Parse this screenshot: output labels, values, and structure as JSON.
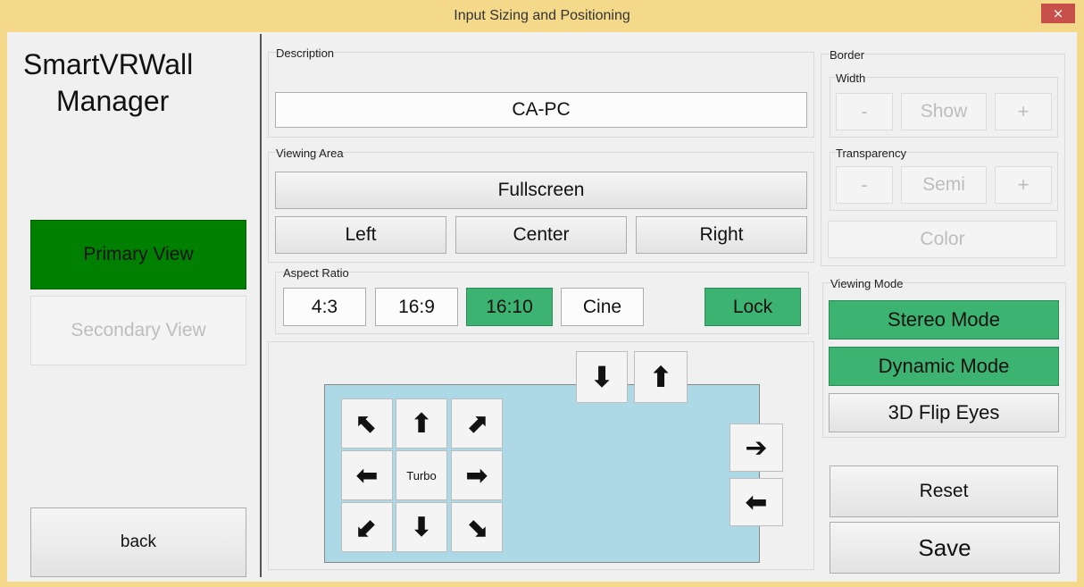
{
  "window": {
    "title": "Input Sizing and Positioning",
    "close_label": "×"
  },
  "sidebar": {
    "app_title_line1": "SmartVRWall",
    "app_title_line2": "Manager",
    "primary_view": "Primary View",
    "secondary_view": "Secondary View",
    "back": "back"
  },
  "description": {
    "label": "Description",
    "value": "CA-PC"
  },
  "viewing_area": {
    "label": "Viewing Area",
    "fullscreen": "Fullscreen",
    "left": "Left",
    "center": "Center",
    "right": "Right"
  },
  "aspect_ratio": {
    "label": "Aspect Ratio",
    "options": [
      "4:3",
      "16:9",
      "16:10",
      "Cine"
    ],
    "selected": "16:10",
    "lock": "Lock"
  },
  "position_pad": {
    "turbo": "Turbo",
    "arrows": {
      "up_left": "⬉",
      "up": "⬆",
      "up_right": "⬈",
      "left": "⬅",
      "right": "➡",
      "down_left": "⬋",
      "down": "⬇",
      "down_right": "⬊"
    }
  },
  "size_controls": {
    "shrink_height": "⬇",
    "grow_height": "⬆",
    "grow_width": "➔",
    "shrink_width": "⬅"
  },
  "border": {
    "label": "Border",
    "width_label": "Width",
    "minus": "-",
    "show": "Show",
    "plus": "+",
    "transparency_label": "Transparency",
    "semi": "Semi",
    "color": "Color"
  },
  "viewing_mode": {
    "label": "Viewing Mode",
    "stereo": "Stereo Mode",
    "dynamic": "Dynamic Mode",
    "flip": "3D Flip Eyes"
  },
  "actions": {
    "reset": "Reset",
    "save": "Save"
  },
  "colors": {
    "accent_green": "#3cb371",
    "primary_green": "#008000",
    "canvas_blue": "#add8e6",
    "title_bar": "#f5d98a"
  }
}
